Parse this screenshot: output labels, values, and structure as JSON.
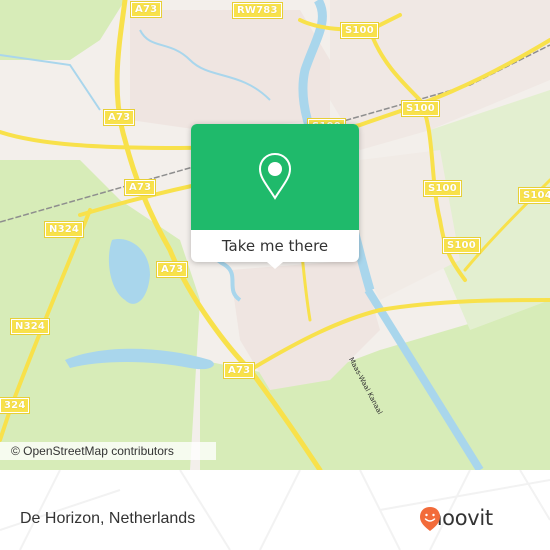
{
  "map": {
    "road_labels": [
      {
        "id": "a73-top",
        "text": "A73"
      },
      {
        "id": "rw783",
        "text": "RW783"
      },
      {
        "id": "s100-top",
        "text": "S100"
      },
      {
        "id": "a73-left",
        "text": "A73"
      },
      {
        "id": "s100-mid",
        "text": "S100"
      },
      {
        "id": "a73-rail",
        "text": "A73"
      },
      {
        "id": "s100-right",
        "text": "S100"
      },
      {
        "id": "s104",
        "text": "S104"
      },
      {
        "id": "n324-a",
        "text": "N324"
      },
      {
        "id": "a73-lake",
        "text": "A73"
      },
      {
        "id": "s100-low",
        "text": "S100"
      },
      {
        "id": "n324-b",
        "text": "N324"
      },
      {
        "id": "a73-south",
        "text": "A73"
      },
      {
        "id": "n324-c",
        "text": "324"
      }
    ],
    "water_label": "Maas-Waal Kanaal",
    "colors": {
      "land": "#f3efeb",
      "urban": "#f1e7e3",
      "green": "#d7ecb8",
      "water": "#a9d6ec",
      "road": "#f8e14b"
    }
  },
  "popup": {
    "icon": "location-pin-icon",
    "cta_label": "Take me there",
    "accent": "#1fba6b"
  },
  "attribution": "© OpenStreetMap contributors",
  "footer": {
    "place_name": "De Horizon, Netherlands",
    "brand": "moovit",
    "brand_color": "#f26b3a"
  }
}
